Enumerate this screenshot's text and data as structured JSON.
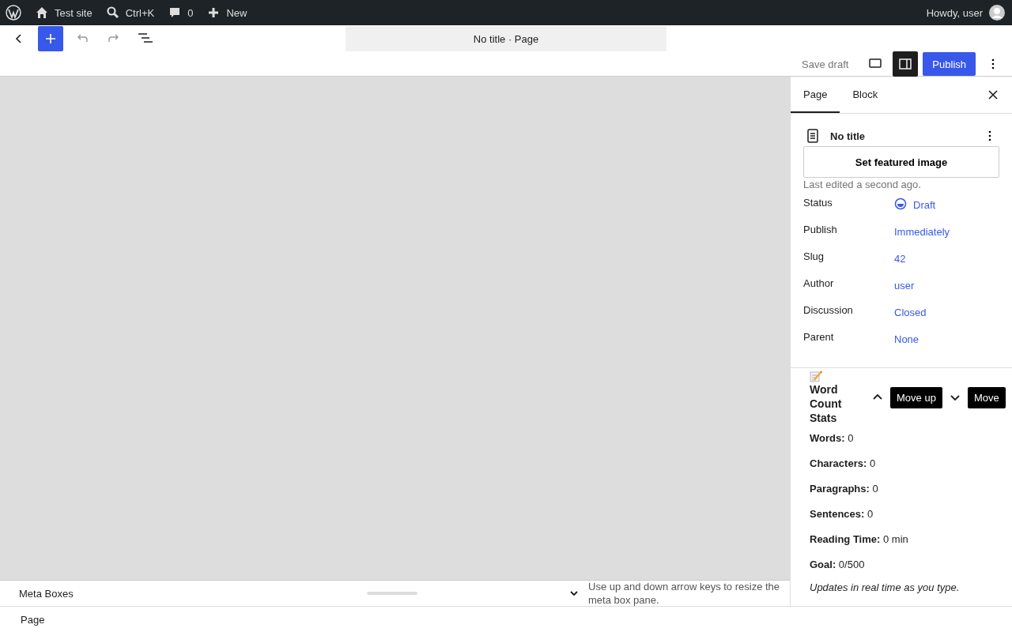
{
  "admin_bar": {
    "site": "Test site",
    "search_shortcut": "Ctrl+K",
    "comments": "0",
    "new": "New",
    "greeting": "Howdy, user"
  },
  "header": {
    "document_title": "No title · Page",
    "save_draft": "Save draft",
    "publish": "Publish",
    "settings_on": true
  },
  "sidebar": {
    "tabs": [
      {
        "label": "Page",
        "selected": true
      },
      {
        "label": "Block",
        "selected": false
      }
    ],
    "title": "No title",
    "featured_image": "Set featured image",
    "last_edited": "Last edited a second ago.",
    "rows": [
      {
        "label": "Status",
        "value": "Draft",
        "kind": "status"
      },
      {
        "label": "Publish",
        "value": "Immediately",
        "kind": "link"
      },
      {
        "label": "Slug",
        "value": "42",
        "kind": "link"
      },
      {
        "label": "Author",
        "value": "user",
        "kind": "link"
      },
      {
        "label": "Discussion",
        "value": "Closed",
        "kind": "link"
      },
      {
        "label": "Parent",
        "value": "None",
        "kind": "link"
      }
    ],
    "widget": {
      "title": "Word Count Stats",
      "tooltips": [
        "Move up",
        "Move"
      ],
      "stats": [
        "**Words:** 0",
        "**Characters:** 0",
        "**Paragraphs:** 0",
        "**Sentences:** 0",
        "**Reading Time:** 0 min",
        "**Goal:** 0/500"
      ],
      "note": "Updates in real time as you type."
    }
  },
  "meta_boxes": {
    "title": "Meta Boxes",
    "hint": "Use up and down arrow keys to resize the meta box pane."
  },
  "footer": {
    "breadcrumb": "Page"
  }
}
